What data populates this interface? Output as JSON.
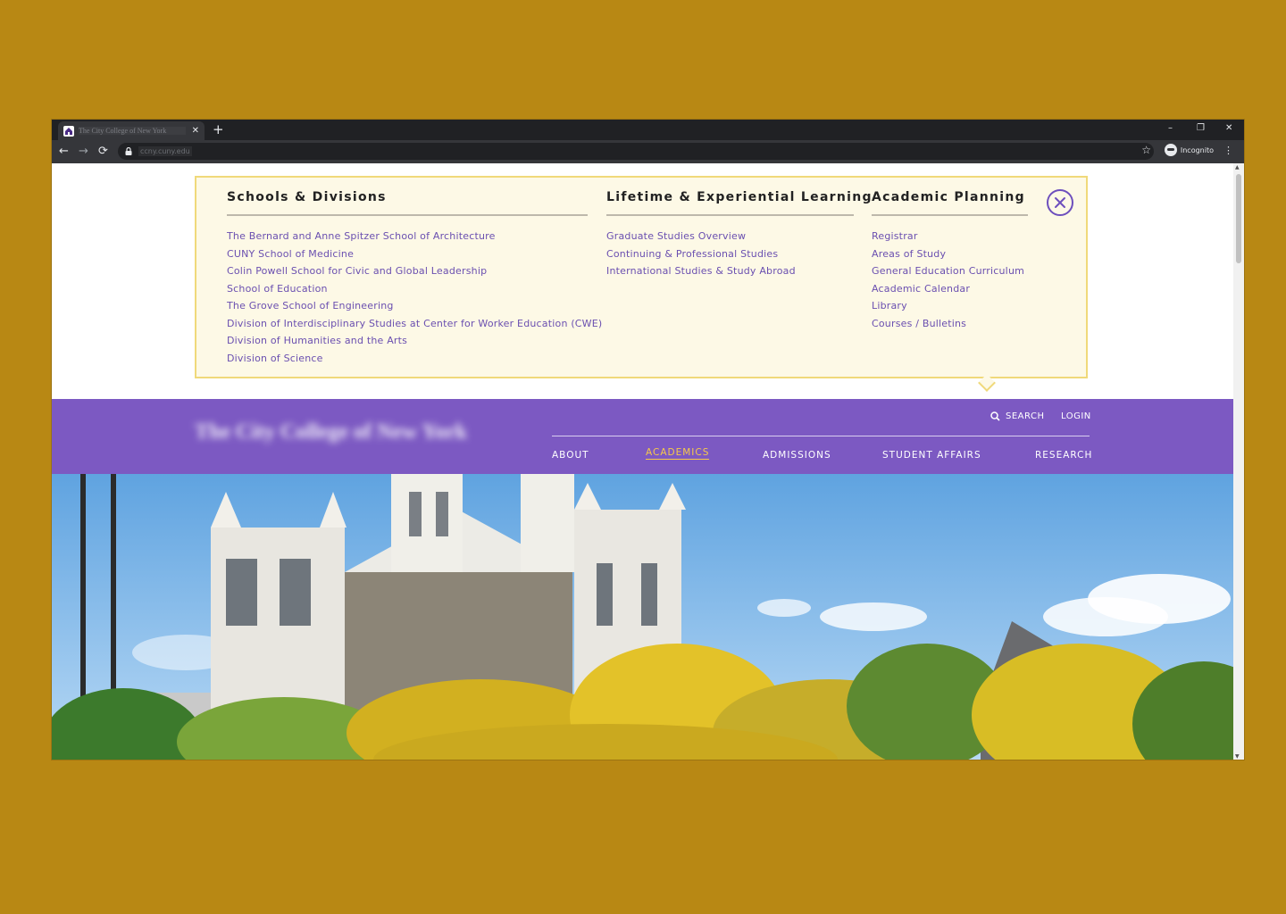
{
  "browser": {
    "tab_title": "The City College of New York",
    "new_tab_symbol": "+",
    "tab_close_symbol": "✕",
    "url": "ccny.cuny.edu",
    "profile_label": "Incognito",
    "window_controls": [
      "–",
      "❐",
      "✕"
    ],
    "nav_symbols": {
      "back": "←",
      "forward": "→",
      "reload": "⟳",
      "star": "☆",
      "menu": "⋮"
    }
  },
  "mega_menu": {
    "columns": [
      {
        "heading": "Schools & Divisions",
        "links": [
          "The Bernard and Anne Spitzer School of Architecture",
          "CUNY School of Medicine",
          "Colin Powell School for Civic and Global Leadership",
          "School of Education",
          "The Grove School of Engineering",
          "Division of Interdisciplinary Studies at Center for Worker Education (CWE)",
          "Division of Humanities and the Arts",
          "Division of Science"
        ]
      },
      {
        "heading": "Lifetime & Experiential Learning",
        "links": [
          "Graduate Studies Overview",
          "Continuing & Professional Studies",
          "International Studies & Study Abroad"
        ]
      },
      {
        "heading": "Academic Planning",
        "links": [
          "Registrar",
          "Areas of Study",
          "General Education Curriculum",
          "Academic Calendar",
          "Library",
          "Courses / Bulletins"
        ]
      }
    ],
    "close_icon": "close-icon"
  },
  "header": {
    "logo_text": "The City College of New York",
    "search_label": "SEARCH",
    "login_label": "LOGIN",
    "nav": [
      "ABOUT",
      "ACADEMICS",
      "ADMISSIONS",
      "STUDENT AFFAIRS",
      "RESEARCH"
    ],
    "active_nav": "ACADEMICS"
  },
  "colors": {
    "brand_purple": "#7c59c2",
    "link_purple": "#6a4fb0",
    "accent_gold": "#f6c94a",
    "menu_bg": "#fdf9e6",
    "menu_border": "#f0d97a",
    "backdrop": "#b88814"
  }
}
